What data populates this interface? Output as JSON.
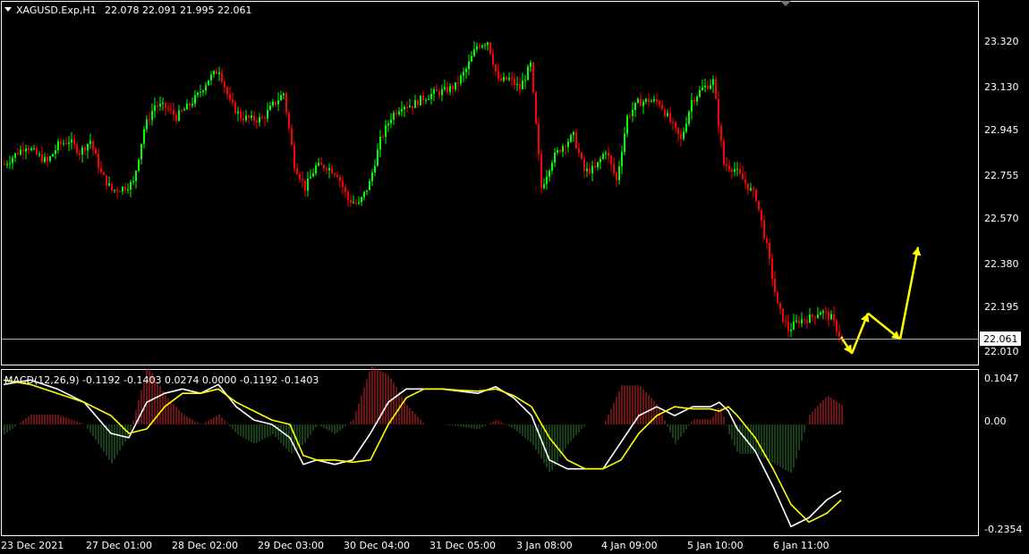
{
  "header": {
    "symbol": "XAGUSD.Exp,H1",
    "ohlc": "22.078 22.091 21.995 22.061",
    "macd_label": "MACD(12,26,9) -0.1192 -0.1403 0.0274 0.0000 -0.1192 -0.1403"
  },
  "colors": {
    "background": "#000000",
    "frame": "#ffffff",
    "bull": "#00ff00",
    "bear": "#ff0000",
    "arrow": "#ffff00",
    "macd_line": "#ffffff",
    "signal_line": "#ffff00",
    "hist_pos": "#d42a2a",
    "hist_neg": "#2e7d32"
  },
  "chart_data": [
    {
      "type": "candlestick",
      "title": "XAGUSD.Exp,H1",
      "current_price": "22.061",
      "y_ticks": [
        "23.320",
        "23.130",
        "22.945",
        "22.755",
        "22.570",
        "22.380",
        "22.195",
        "22.010"
      ],
      "ylim": [
        21.98,
        23.42
      ],
      "x_ticks": [
        "23 Dec 2021",
        "27 Dec 01:00",
        "28 Dec 02:00",
        "29 Dec 03:00",
        "30 Dec 04:00",
        "31 Dec 05:00",
        "3 Jan 08:00",
        "4 Jan 09:00",
        "5 Jan 10:00",
        "6 Jan 11:00"
      ],
      "close_path": [
        [
          0,
          22.8
        ],
        [
          12,
          22.84
        ],
        [
          24,
          22.88
        ],
        [
          36,
          22.84
        ],
        [
          48,
          22.81
        ],
        [
          60,
          22.88
        ],
        [
          72,
          22.9
        ],
        [
          84,
          22.85
        ],
        [
          96,
          22.9
        ],
        [
          108,
          22.76
        ],
        [
          120,
          22.69
        ],
        [
          132,
          22.7
        ],
        [
          144,
          22.72
        ],
        [
          156,
          22.95
        ],
        [
          168,
          23.05
        ],
        [
          180,
          23.04
        ],
        [
          192,
          23.0
        ],
        [
          204,
          23.04
        ],
        [
          216,
          23.09
        ],
        [
          228,
          23.16
        ],
        [
          240,
          23.2
        ],
        [
          252,
          23.06
        ],
        [
          264,
          23.0
        ],
        [
          276,
          22.99
        ],
        [
          288,
          22.99
        ],
        [
          300,
          23.05
        ],
        [
          312,
          23.1
        ],
        [
          324,
          22.8
        ],
        [
          336,
          22.7
        ],
        [
          348,
          22.79
        ],
        [
          360,
          22.79
        ],
        [
          372,
          22.76
        ],
        [
          384,
          22.65
        ],
        [
          396,
          22.63
        ],
        [
          408,
          22.72
        ],
        [
          420,
          22.9
        ],
        [
          432,
          23.0
        ],
        [
          444,
          23.05
        ],
        [
          456,
          23.05
        ],
        [
          468,
          23.08
        ],
        [
          480,
          23.1
        ],
        [
          492,
          23.11
        ],
        [
          504,
          23.13
        ],
        [
          516,
          23.2
        ],
        [
          528,
          23.3
        ],
        [
          540,
          23.32
        ],
        [
          552,
          23.15
        ],
        [
          564,
          23.16
        ],
        [
          576,
          23.12
        ],
        [
          588,
          23.22
        ],
        [
          600,
          22.7
        ],
        [
          612,
          22.82
        ],
        [
          624,
          22.88
        ],
        [
          636,
          22.92
        ],
        [
          648,
          22.77
        ],
        [
          660,
          22.78
        ],
        [
          672,
          22.86
        ],
        [
          684,
          22.73
        ],
        [
          696,
          23.0
        ],
        [
          708,
          23.06
        ],
        [
          720,
          23.07
        ],
        [
          732,
          23.06
        ],
        [
          744,
          22.98
        ],
        [
          756,
          22.9
        ],
        [
          768,
          23.07
        ],
        [
          780,
          23.12
        ],
        [
          792,
          23.15
        ],
        [
          804,
          22.8
        ],
        [
          816,
          22.78
        ],
        [
          828,
          22.72
        ],
        [
          840,
          22.66
        ],
        [
          852,
          22.45
        ],
        [
          864,
          22.2
        ],
        [
          876,
          22.1
        ],
        [
          888,
          22.14
        ],
        [
          900,
          22.15
        ],
        [
          912,
          22.18
        ],
        [
          924,
          22.15
        ],
        [
          936,
          22.06
        ]
      ],
      "projection_path": [
        [
          936,
          22.07
        ],
        [
          948,
          22.0
        ],
        [
          966,
          22.17
        ],
        [
          1002,
          22.06
        ],
        [
          1022,
          22.45
        ]
      ]
    },
    {
      "type": "line",
      "title": "MACD(12,26,9) -0.1192 -0.1403 0.0274 0.0000 -0.1192 -0.1403",
      "y_ticks": [
        "0.1047",
        "0.00",
        "-0.2354"
      ],
      "ylim": [
        -0.2354,
        0.1047
      ],
      "x": [
        0,
        30,
        60,
        90,
        120,
        140,
        160,
        180,
        200,
        220,
        240,
        260,
        280,
        300,
        320,
        335,
        350,
        370,
        390,
        410,
        430,
        450,
        470,
        490,
        510,
        530,
        550,
        570,
        590,
        610,
        630,
        650,
        670,
        690,
        710,
        730,
        750,
        770,
        790,
        800,
        810,
        820,
        840,
        860,
        880,
        900,
        920,
        936
      ],
      "series": [
        {
          "values": [
            0.09,
            0.1,
            0.08,
            0.05,
            -0.02,
            -0.03,
            0.05,
            0.07,
            0.08,
            0.07,
            0.09,
            0.04,
            0.01,
            0.0,
            -0.03,
            -0.09,
            -0.08,
            -0.09,
            -0.08,
            -0.02,
            0.05,
            0.08,
            0.08,
            0.08,
            0.075,
            0.07,
            0.085,
            0.06,
            0.02,
            -0.08,
            -0.1,
            -0.1,
            -0.1,
            -0.04,
            0.02,
            0.04,
            0.02,
            0.04,
            0.04,
            0.05,
            0.03,
            -0.01,
            -0.06,
            -0.14,
            -0.23,
            -0.21,
            -0.17,
            -0.15
          ]
        },
        {
          "values": [
            0.1,
            0.09,
            0.07,
            0.05,
            0.02,
            -0.02,
            -0.01,
            0.04,
            0.07,
            0.07,
            0.08,
            0.05,
            0.03,
            0.01,
            0.0,
            -0.07,
            -0.08,
            -0.08,
            -0.085,
            -0.08,
            0.0,
            0.06,
            0.08,
            0.08,
            0.077,
            0.075,
            0.08,
            0.065,
            0.04,
            -0.03,
            -0.08,
            -0.1,
            -0.1,
            -0.08,
            -0.02,
            0.02,
            0.04,
            0.035,
            0.035,
            0.03,
            0.04,
            0.02,
            -0.03,
            -0.1,
            -0.18,
            -0.22,
            -0.2,
            -0.17
          ]
        }
      ]
    }
  ]
}
